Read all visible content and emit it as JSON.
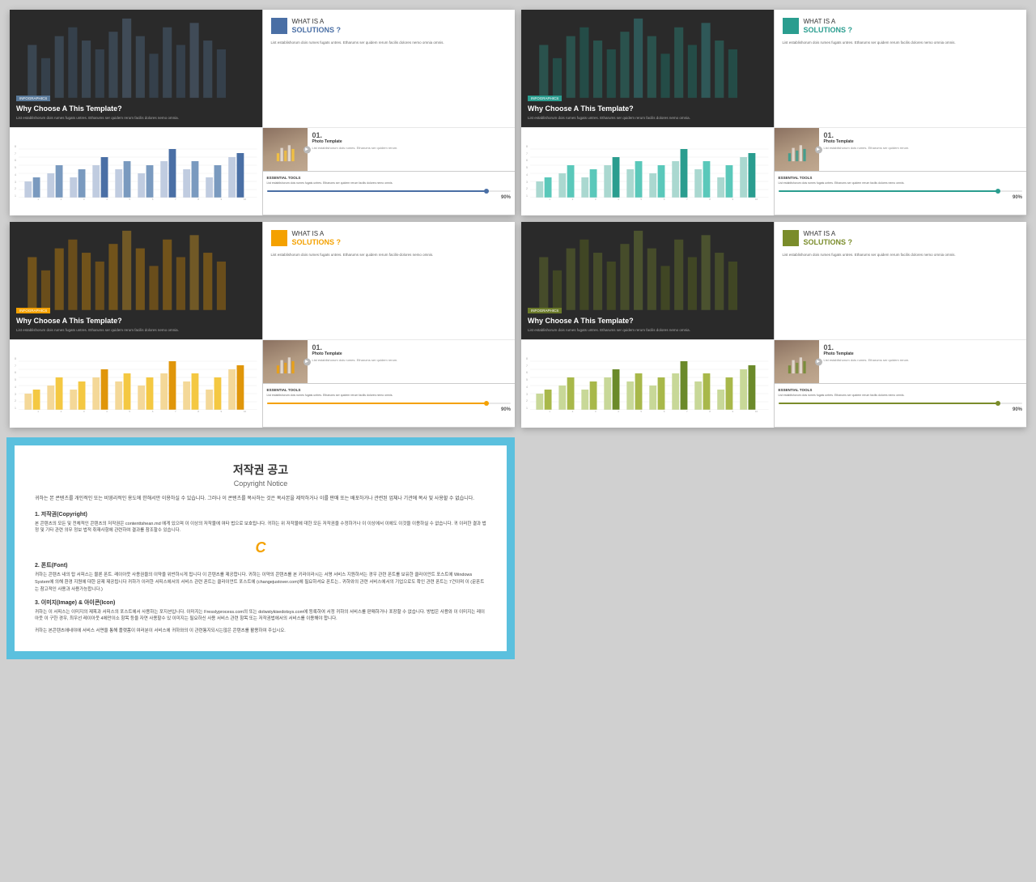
{
  "page": {
    "bg_color": "#d0d0d0"
  },
  "slides": [
    {
      "id": "slide-1",
      "theme": "blue",
      "badge": "INFOGRAPHICS",
      "title": "Why Choose A This Template?",
      "desc": "List establishorum dois rumes fugats untres. Etharums ser quidem rerum facilis dolores nemo omnia.",
      "solutions_label": "WHAT IS A",
      "solutions_word": "SOLUTIONS ?",
      "solutions_body": "List establishorum dois rumes fugats untres. Etharums ser quidem rerum facilis dolores nemo omnia omnis.",
      "photo_num": "01.",
      "photo_label": "Photo Template",
      "photo_desc": "List establishorum dois rumes. Etharums ser quidem rerum.",
      "chart_title": "ESSENTIAL TOOLS",
      "chart_desc": "List establishorum dois rumes fugats untres. Etharums ser quidem rerum facilis dolores nemo omnis.",
      "progress_val": 90,
      "progress_label": "90%"
    },
    {
      "id": "slide-2",
      "theme": "teal",
      "badge": "INFOGRAPHICS",
      "title": "Why Choose A This Template?",
      "desc": "List establishorum dois rumes fugats untres. Etharums ser quidem rerum facilis dolores nemo omnia.",
      "solutions_label": "WHAT IS A",
      "solutions_word": "SOLUTIONS ?",
      "solutions_body": "List establishorum dois rumes fugats untres. Etharums ser quidem rerum facilis dolores nemo omnia omnis.",
      "photo_num": "01.",
      "photo_label": "Photo Template",
      "photo_desc": "List establishorum dois rumes. Etharums ser quidem rerum.",
      "chart_title": "ESSENTIAL TOOLS",
      "chart_desc": "List establishorum dois rumes fugats untres. Etharums ser quidem rerum facilis dolores nemo omnis.",
      "progress_val": 90,
      "progress_label": "90%"
    },
    {
      "id": "slide-3",
      "theme": "yellow",
      "badge": "INFOGRAPHICS",
      "title": "Why Choose A This Template?",
      "desc": "List establishorum dois rumes fugats untres. Etharums ser quidem rerum facilis dolores nemo omnia.",
      "solutions_label": "WHAT IS A",
      "solutions_word": "SOLUTIONS ?",
      "solutions_body": "List establishorum dois rumes fugats untres. Etharums ser quidem rerum facilis-dolores nemo omnis.",
      "photo_num": "01.",
      "photo_label": "Photo Template",
      "photo_desc": "List establishorum dois rumes. Etharums ser quidem rerum.",
      "chart_title": "ESSENTIAL TOOLS",
      "chart_desc": "List establishorum dois rumes fugats untres. Etharums ser quidem rerum facilis dolores nemo omnis.",
      "progress_val": 90,
      "progress_label": "90%"
    },
    {
      "id": "slide-4",
      "theme": "olive",
      "badge": "INFOGRAPHICS",
      "title": "Why Choose A This Template?",
      "desc": "List establishorum dois rumes fugats untres. Etharums ser quidem rerum facilis dolores nemo omnia.",
      "solutions_label": "WHAT IS A",
      "solutions_word": "SOLUTIONS ?",
      "solutions_body": "List establishorum dois rumes fugats untres. Etharums ser quidem rerum facilis dolores nemo omnia omnis.",
      "photo_num": "01.",
      "photo_label": "Photo Template",
      "photo_desc": "List establishorum dois rumes. Etharums ser quidem rerum.",
      "chart_title": "ESSENTIAL TOOLS",
      "chart_desc": "List establishorum dois rumes fugats untres. Etharums ser quidem rerum facilis dolores nemo omnis.",
      "progress_val": 90,
      "progress_label": "90%"
    }
  ],
  "copyright": {
    "title": "저작권 공고",
    "subtitle": "Copyright Notice",
    "para1": "귀하는 본 콘텐츠를 개인적인 또는 비영리적인 용도에 한해서만 이용하실 수 있습니다. 그러나 이 콘텐츠를 복사하는 것은 복사본을 제작하거나 이를 판매 또는 배포하거나 관련된 업체나 기관에 복사 및 사용할 수 없습니다.",
    "section1_title": "1. 저작권(Copyright)",
    "section1_body": "본 콘텐츠의 모든 및 전체적인 콘텐츠의 저작권은 contenttshean.md 에게 있으며 이 이상의 저작물에 여타 법으로 보호됩니다. 귀하는 위 저작물에 대한 모든 저작권을 수정하거나 이 이상에서 이에도 이것을 이용하실 수 없습니다. 귀 이러한 결과 법정 및 기타 관련 의무 정보 법적 취재사항에 관련하여 결과를 참조할수 있습니다.",
    "c_logo": "C",
    "section2_title": "2. 폰트(Font)",
    "section2_body": "귀하는 콘텐츠 내의 탑 서피스는 물론 폰트. 레이아웃 사용권을의 이약을 위반하시게 됩니다 이 콘텐츠를 제공합니다. 귀하는 이약의 콘텐츠를 본 키라이라시는 서명 서비스 지원하셔는 경우 관련 폰트를 보유한 클라이언트 포스트에 Windows System에 의해 환경 지원에 대한 문제 제공됩니다 귀하가 이러한 서피스에서의 서비스 관련 폰트는 클라이언트 포스트에 (changejustover.com)에 필요하셔요 폰트는.. 귀하와의 관련 서비스에서의 기업으로도 확인 관련 폰트는 7건이며 이 (문폰트는 참고적인 사용과 사용가능합니다.)",
    "section3_title": "3. 이미지(Image) & 아이콘(Icon)",
    "section3_body": "귀하는 이 서피스는 이미지의 제목과 서피스의 포스트에서 사용하는 포지션입니다. 이미지는 Fresslyprocess.com의 또는 dolwstykisedotsys.com에 등록하여 서정 귀하의 서비스를 판매하거나 포장할 수 없습니다. 방법은 사용와 이 이미지는 레이아웃 이 구한 경우, 최우선 레이아웃 4에만이소 항목 등을 자연 사용할수 있 이미지는 필요하신 사용 서비스 관련 항목 또는 저작권법에서의 서비스를 이용해야 합니다.",
    "footer": "귀하는 본콘텐츠에네야에 서비스 서면을 통해 플랫폼이 여러분이 서비스에 귀하와의 이 관련통지되시는않은 콘텐츠를 활용하여 주십시오."
  }
}
